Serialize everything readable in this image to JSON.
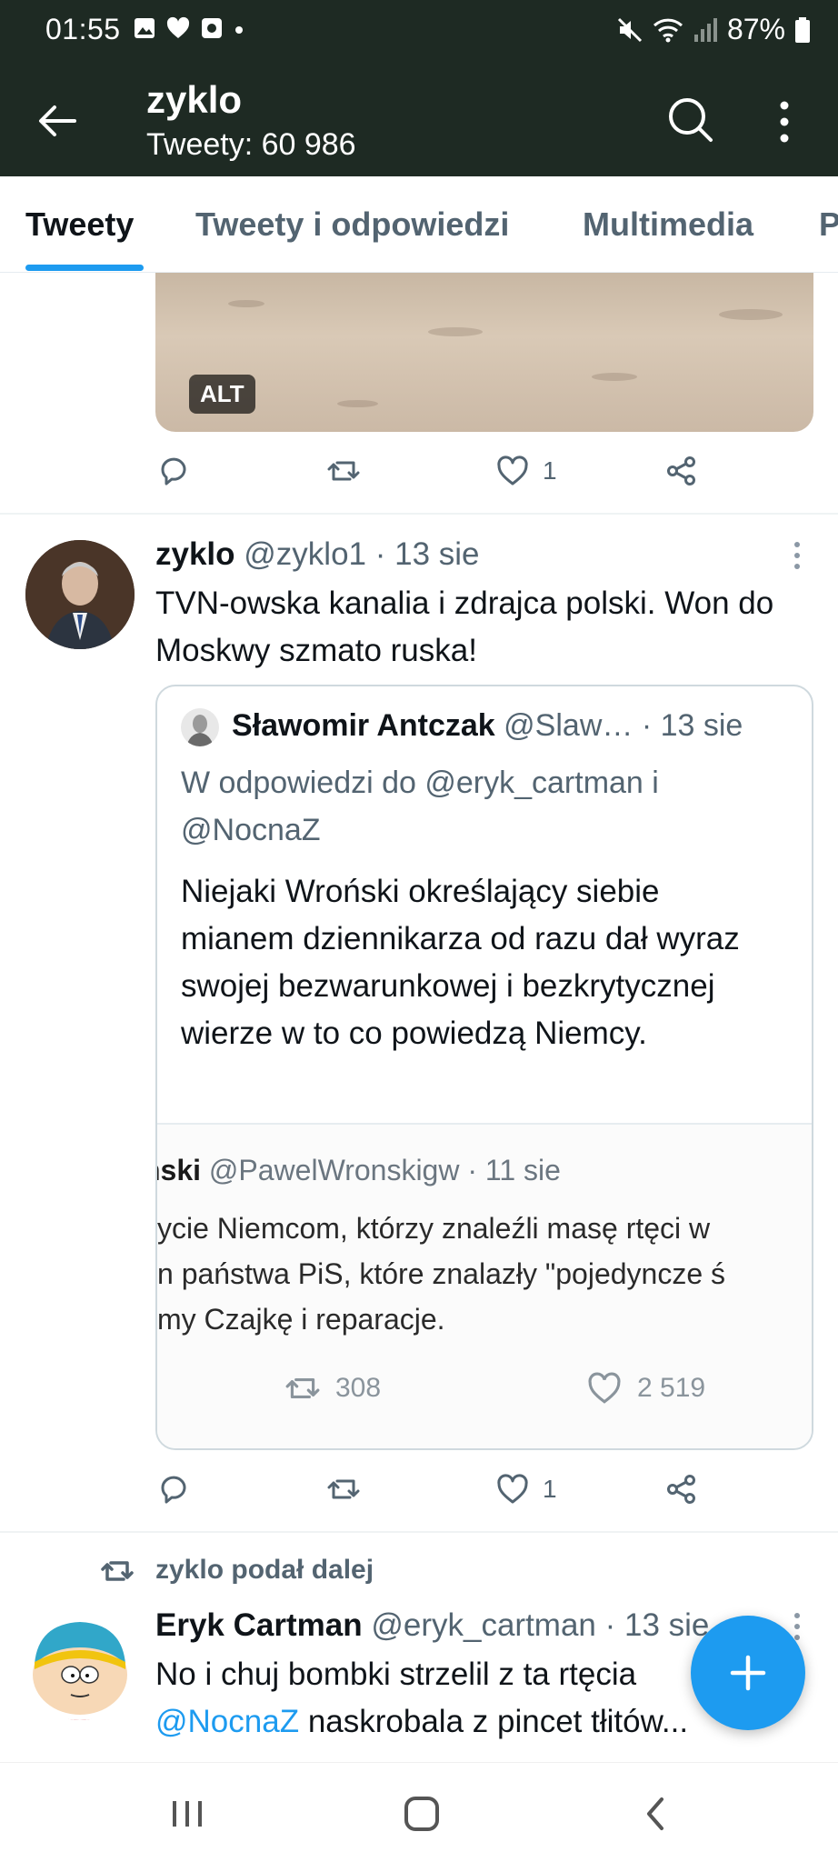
{
  "status_bar": {
    "time": "01:55",
    "battery": "87%"
  },
  "app_bar": {
    "title": "zyklo",
    "subtitle": "Tweety: 60 986"
  },
  "tabs": [
    {
      "label": "Tweety",
      "active": true
    },
    {
      "label": "Tweety i odpowiedzi",
      "active": false
    },
    {
      "label": "Multimedia",
      "active": false
    },
    {
      "label": "P",
      "active": false
    }
  ],
  "tweet0": {
    "alt_badge": "ALT",
    "like_count": "1"
  },
  "tweet1": {
    "name": "zyklo",
    "meta": "@zyklo1 · 13 sie",
    "text": "TVN-owska kanalia i zdrajca polski. Won do Moskwy szmato ruska!",
    "like_count": "1",
    "quote": {
      "name": "Sławomir Antczak",
      "meta": "@Slaw… · 13 sie",
      "reply_to": "W odpowiedzi do @eryk_cartman i @NocnaZ",
      "text": "Niejaki Wroński określający siebie mianem dziennikarza od razu dał wyraz swojej bezwarunkowej i bezkrytycznej wierze w to co powiedzą Niemcy.",
      "screenshot": {
        "name_fragment": "ński",
        "meta": "@PawelWronskigw · 11 sie",
        "lines": [
          "ycie Niemcom, którzy znaleźli masę rtęci w",
          "n państwa PiS, które znalazły \"pojedyncze ś",
          "my Czajkę i reparacje."
        ],
        "retweets": "308",
        "likes": "2 519"
      }
    }
  },
  "tweet2": {
    "retweeted_by": "zyklo podał dalej",
    "name": "Eryk Cartman",
    "meta": "@eryk_cartman · 13 sie",
    "text_line1": "No i chuj bombki strzelil z ta rtęcia",
    "mention": "@NocnaZ",
    "text_line2": " naskrobala z pincet tłitów..."
  },
  "colors": {
    "header_bg": "#1e2a23",
    "accent": "#1d9bf0",
    "secondary_text": "#536471"
  }
}
